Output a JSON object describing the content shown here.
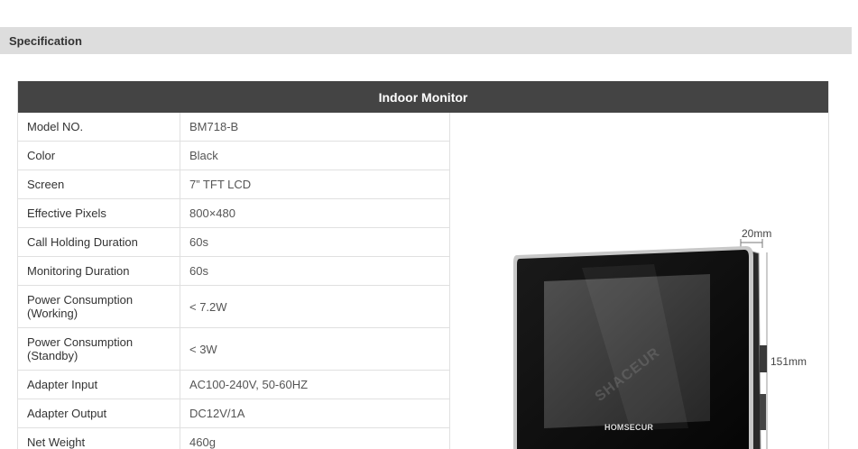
{
  "section": {
    "title": "Specification"
  },
  "table": {
    "title": "Indoor Monitor",
    "rows": [
      {
        "label": "Model NO.",
        "value": "BM718-B"
      },
      {
        "label": "Color",
        "value": "Black"
      },
      {
        "label": "Screen",
        "value": "7” TFT LCD"
      },
      {
        "label": "Effective Pixels",
        "value": "800×480"
      },
      {
        "label": "Call Holding Duration",
        "value": "60s"
      },
      {
        "label": "Monitoring Duration",
        "value": "60s"
      },
      {
        "label": "Power Consumption (Working)",
        "value": "< 7.2W"
      },
      {
        "label": "Power Consumption (Standby)",
        "value": "< 3W"
      },
      {
        "label": "Adapter Input",
        "value": "AC100-240V, 50-60HZ"
      },
      {
        "label": "Adapter Output",
        "value": "DC12V/1A"
      },
      {
        "label": "Net Weight",
        "value": "460g"
      }
    ]
  },
  "product": {
    "brand": "HOMSECUR",
    "watermark": "SHACEUR",
    "depth_label": "20mm",
    "height_label": "151mm"
  }
}
